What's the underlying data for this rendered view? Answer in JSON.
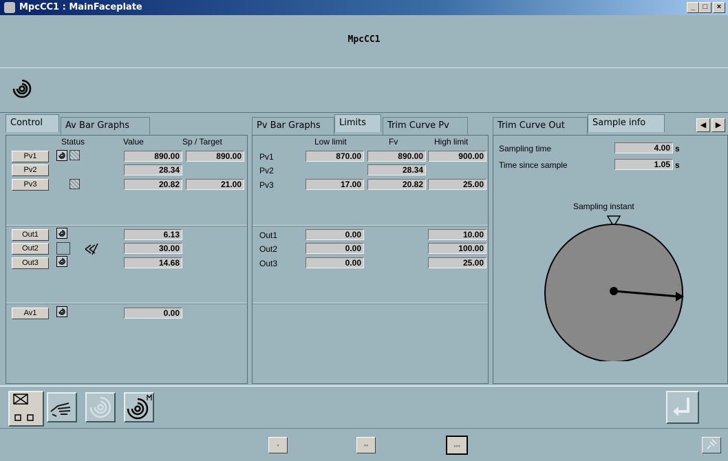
{
  "window": {
    "title": "MpcCC1 : MainFaceplate",
    "controls": [
      "_",
      "□",
      "×"
    ]
  },
  "header": {
    "name": "MpcCC1"
  },
  "control_panel": {
    "tabs": [
      "Control",
      "Av Bar Graphs"
    ],
    "columns": {
      "status": "Status",
      "value": "Value",
      "sp": "Sp / Target"
    },
    "pv": [
      {
        "label": "Pv1",
        "value": "890.00",
        "sp": "890.00"
      },
      {
        "label": "Pv2",
        "value": "28.34"
      },
      {
        "label": "Pv3",
        "value": "20.82",
        "sp": "21.00"
      }
    ],
    "out": [
      {
        "label": "Out1",
        "value": "6.13"
      },
      {
        "label": "Out2",
        "value": "30.00"
      },
      {
        "label": "Out3",
        "value": "14.68"
      }
    ],
    "av": [
      {
        "label": "Av1",
        "value": "0.00"
      }
    ]
  },
  "limits_panel": {
    "tabs": [
      "Pv Bar Graphs",
      "Limits",
      "Trim Curve Pv"
    ],
    "columns": {
      "low": "Low limit",
      "fv": "Fv",
      "high": "High limit"
    },
    "pv": [
      {
        "label": "Pv1",
        "low": "870.00",
        "fv": "890.00",
        "high": "900.00"
      },
      {
        "label": "Pv2",
        "fv": "28.34"
      },
      {
        "label": "Pv3",
        "low": "17.00",
        "fv": "20.82",
        "high": "25.00"
      }
    ],
    "out": [
      {
        "label": "Out1",
        "low": "0.00",
        "high": "10.00"
      },
      {
        "label": "Out2",
        "low": "0.00",
        "high": "100.00"
      },
      {
        "label": "Out3",
        "low": "0.00",
        "high": "25.00"
      }
    ]
  },
  "sample_panel": {
    "tabs": [
      "Trim Curve Out",
      "Sample info"
    ],
    "sampling_time_label": "Sampling time",
    "sampling_time_value": "4.00",
    "since_label": "Time since sample",
    "since_value": "1.05",
    "unit": "s",
    "instant_label": "Sampling instant"
  },
  "footer": {
    "buttons": [
      "◦",
      "◦◦",
      "◦◦◦"
    ]
  }
}
